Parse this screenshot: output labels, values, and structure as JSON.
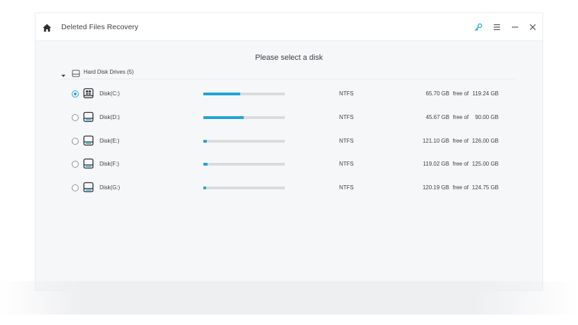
{
  "window": {
    "title": "Deleted Files Recovery"
  },
  "titlebar": {
    "icons": [
      "home-icon",
      "key-icon",
      "menu-icon",
      "minimize-icon",
      "close-icon"
    ]
  },
  "main": {
    "heading": "Please select a disk",
    "group": {
      "label": "Hard Disk Drives (5)",
      "expanded": true
    },
    "free_label": "free of",
    "disks": [
      {
        "name": "Disk(C:)",
        "fs": "NTFS",
        "free": "65.70 GB",
        "total": "119.24 GB",
        "used_fraction": 0.449,
        "selected": true,
        "icon": "system-drive-icon"
      },
      {
        "name": "Disk(D:)",
        "fs": "NTFS",
        "free": "45.67 GB",
        "total": "90.00 GB",
        "used_fraction": 0.493,
        "selected": false,
        "icon": "drive-icon"
      },
      {
        "name": "Disk(E:)",
        "fs": "NTFS",
        "free": "121.10 GB",
        "total": "126.00 GB",
        "used_fraction": 0.039,
        "selected": false,
        "icon": "drive-icon"
      },
      {
        "name": "Disk(F:)",
        "fs": "NTFS",
        "free": "119.02 GB",
        "total": "125.00 GB",
        "used_fraction": 0.048,
        "selected": false,
        "icon": "drive-icon"
      },
      {
        "name": "Disk(G:)",
        "fs": "NTFS",
        "free": "120.19 GB",
        "total": "124.75 GB",
        "used_fraction": 0.037,
        "selected": false,
        "icon": "drive-icon"
      }
    ]
  },
  "colors": {
    "accent": "#1fa4d6",
    "bar_track": "#d9dcdf",
    "text": "#3a3f45",
    "background": "#f6f7f9"
  }
}
